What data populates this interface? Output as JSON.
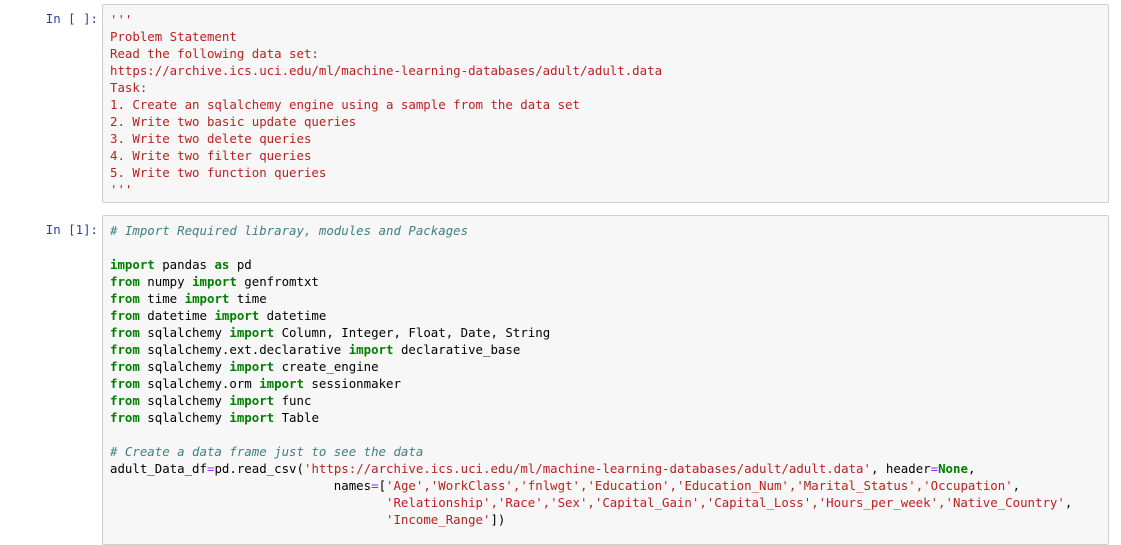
{
  "cell1": {
    "prompt": "In [ ]:",
    "lines": [
      "'''",
      "Problem Statement",
      "Read the following data set:",
      "https://archive.ics.uci.edu/ml/machine-learning-databases/adult/adult.data",
      "Task:",
      "1. Create an sqlalchemy engine using a sample from the data set",
      "2. Write two basic update queries",
      "3. Write two delete queries",
      "4. Write two filter queries",
      "5. Write two function queries",
      "'''"
    ]
  },
  "cell2": {
    "prompt": "In [1]:",
    "comment1": "# Import Required libraray, modules and Packages",
    "imports": [
      {
        "kw1": "import",
        "mod": " pandas ",
        "kw2": "as",
        "name": " pd"
      },
      {
        "kw1": "from",
        "mod": " numpy ",
        "kw2": "import",
        "name": " genfromtxt"
      },
      {
        "kw1": "from",
        "mod": " time ",
        "kw2": "import",
        "name": " time"
      },
      {
        "kw1": "from",
        "mod": " datetime ",
        "kw2": "import",
        "name": " datetime"
      },
      {
        "kw1": "from",
        "mod": " sqlalchemy ",
        "kw2": "import",
        "name": " Column, Integer, Float, Date, String"
      },
      {
        "kw1": "from",
        "mod": " sqlalchemy.ext.declarative ",
        "kw2": "import",
        "name": " declarative_base"
      },
      {
        "kw1": "from",
        "mod": " sqlalchemy ",
        "kw2": "import",
        "name": " create_engine"
      },
      {
        "kw1": "from",
        "mod": " sqlalchemy.orm ",
        "kw2": "import",
        "name": " sessionmaker"
      },
      {
        "kw1": "from",
        "mod": " sqlalchemy ",
        "kw2": "import",
        "name": " func"
      },
      {
        "kw1": "from",
        "mod": " sqlalchemy ",
        "kw2": "import",
        "name": " Table"
      }
    ],
    "comment2": "# Create a data frame just to see the data",
    "read_prefix": "adult_Data_df",
    "read_eq": "=",
    "read_call": "pd.read_csv(",
    "read_url": "'https://archive.ics.uci.edu/ml/machine-learning-databases/adult/adult.data'",
    "read_header_key": ", header",
    "read_header_eq": "=",
    "read_header_val": "None",
    "read_tail": ",",
    "names_indent": "                              ",
    "names_key": "names",
    "names_eq": "=",
    "names_open": "[",
    "names_line1": "'Age','WorkClass','fnlwgt','Education','Education_Num','Marital_Status','Occupation'",
    "names_line1_end": ",",
    "names_indent2": "                                     ",
    "names_line2": "'Relationship','Race','Sex','Capital_Gain','Capital_Loss','Hours_per_week','Native_Country'",
    "names_line2_end": ",",
    "names_line3": "'Income_Range'",
    "names_close": "])"
  }
}
